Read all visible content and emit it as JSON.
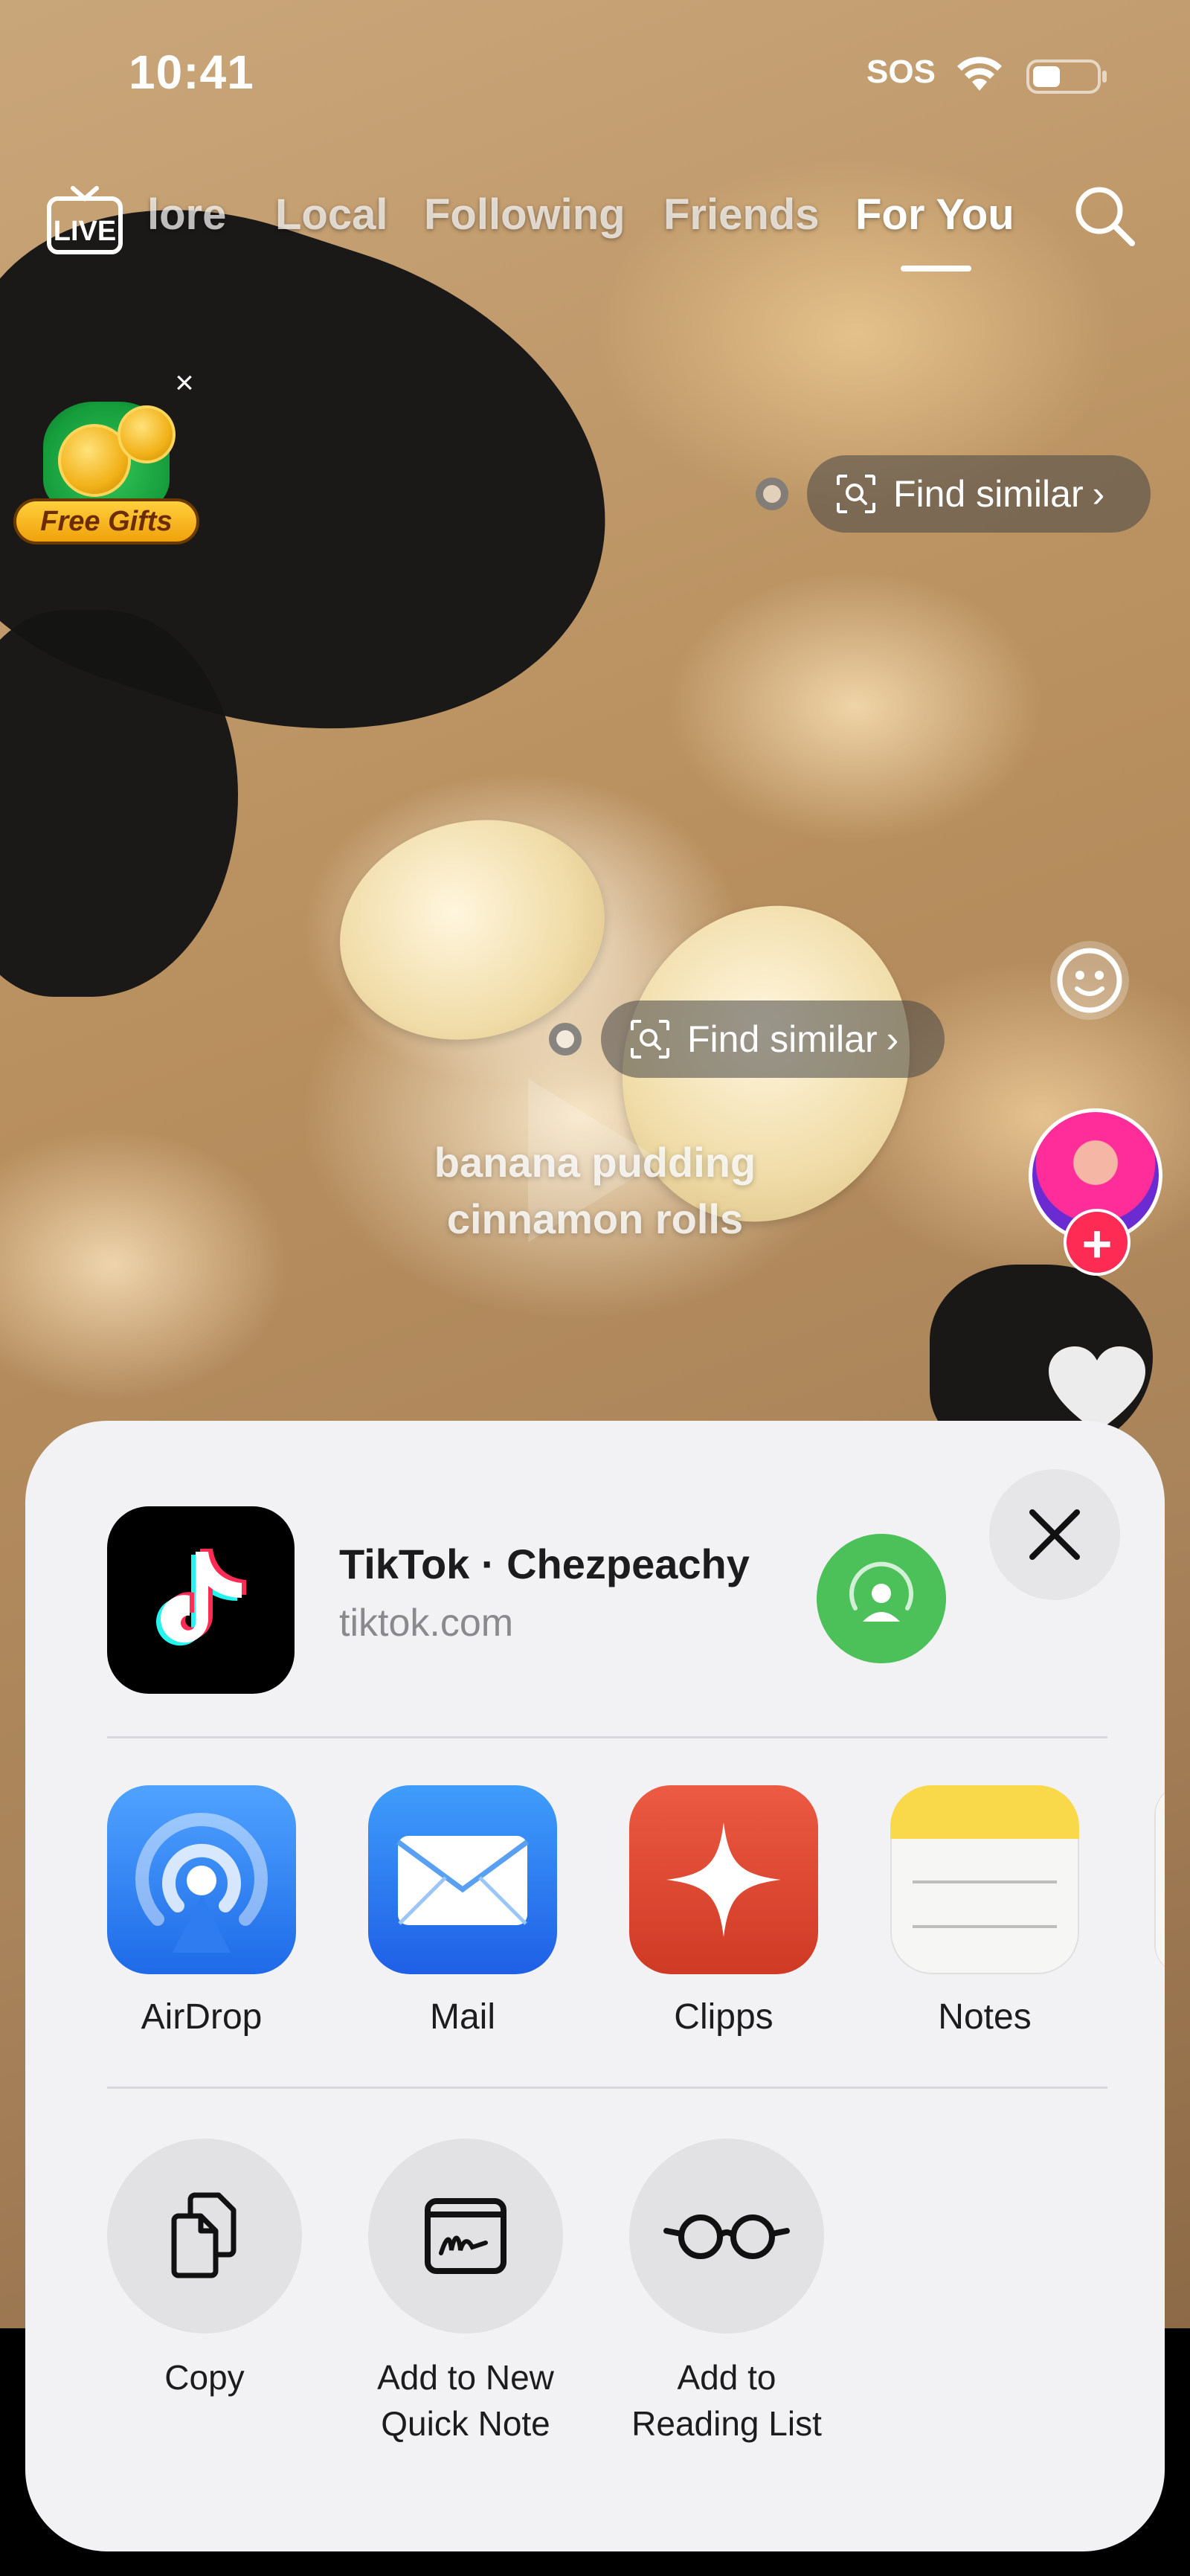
{
  "status_bar": {
    "time": "10:41",
    "sos": "SOS",
    "icons": [
      "wifi-icon",
      "battery-icon"
    ]
  },
  "top_nav": {
    "live_badge": "LIVE",
    "tabs": [
      {
        "label": "lore"
      },
      {
        "label": "Local"
      },
      {
        "label": "Following"
      },
      {
        "label": "Friends"
      },
      {
        "label": "For You",
        "active": true
      }
    ],
    "search_icon": "search-icon"
  },
  "promo": {
    "label": "Free Gifts",
    "close": "×"
  },
  "find_similar": {
    "label": "Find similar"
  },
  "video": {
    "caption": "banana pudding cinnamon rolls"
  },
  "share_sheet": {
    "title": "TikTok · Chezpeachy",
    "url": "tiktok.com",
    "apps": [
      {
        "label": "AirDrop",
        "icon": "airdrop-icon",
        "color": "#2f7bf0"
      },
      {
        "label": "Mail",
        "icon": "mail-icon",
        "color": "#2b76ee"
      },
      {
        "label": "Clipps",
        "icon": "clipps-icon",
        "color": "#e04530"
      },
      {
        "label": "Notes",
        "icon": "notes-icon",
        "color": "#f9d84a"
      }
    ],
    "actions": [
      {
        "label": "Copy",
        "icon": "copy-icon"
      },
      {
        "label": "Add to New Quick Note",
        "icon": "quick-note-icon"
      },
      {
        "label": "Add to Reading List",
        "icon": "glasses-icon"
      }
    ]
  },
  "colors": {
    "sheet_bg": "#f2f2f4",
    "airdrop_green": "#4cc15a",
    "follow_red": "#fe2c55"
  }
}
